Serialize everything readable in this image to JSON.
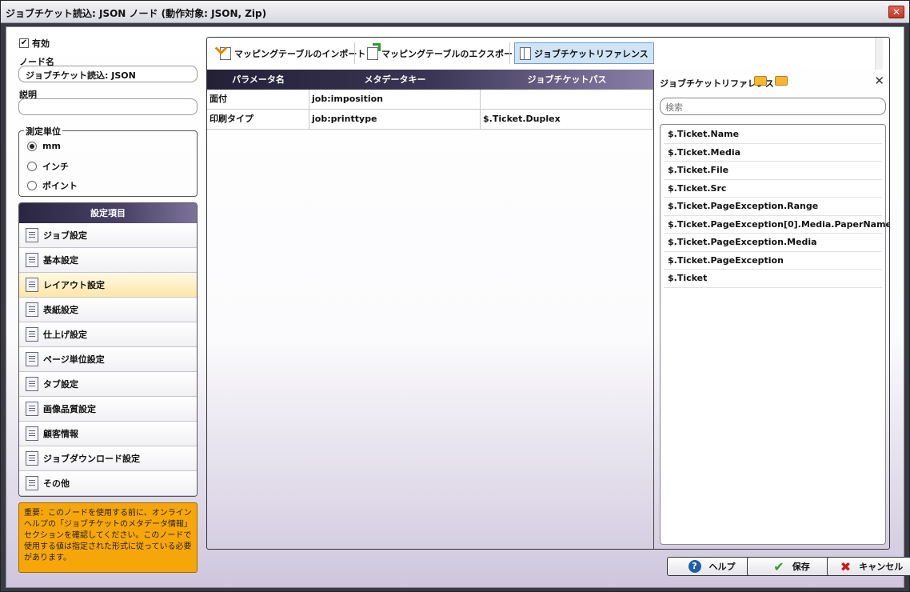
{
  "window": {
    "title": "ジョブチケット読込: JSON ノード (動作対象: JSON, Zip)"
  },
  "left": {
    "enabled_label": "有効",
    "enabled_checked": true,
    "node_name_label": "ノード名",
    "node_name_value": "ジョブチケット読込: JSON",
    "description_label": "説明",
    "description_value": "",
    "unit_group_label": "測定単位",
    "units": [
      {
        "label": "mm",
        "selected": true
      },
      {
        "label": "インチ",
        "selected": false
      },
      {
        "label": "ポイント",
        "selected": false
      }
    ],
    "settings_header": "設定項目",
    "settings_items": [
      {
        "label": "ジョブ設定",
        "icon": "document-icon",
        "active": false
      },
      {
        "label": "基本設定",
        "icon": "list-icon",
        "active": false
      },
      {
        "label": "レイアウト設定",
        "icon": "layout-icon",
        "active": true
      },
      {
        "label": "表紙設定",
        "icon": "cover-icon",
        "active": false
      },
      {
        "label": "仕上げ設定",
        "icon": "finishing-icon",
        "active": false
      },
      {
        "label": "ページ単位設定",
        "icon": "pages-icon",
        "active": false
      },
      {
        "label": "タブ設定",
        "icon": "tab-icon",
        "active": false
      },
      {
        "label": "画像品質設定",
        "icon": "image-icon",
        "active": false
      },
      {
        "label": "顧客情報",
        "icon": "customer-icon",
        "active": false
      },
      {
        "label": "ジョブダウンロード設定",
        "icon": "download-icon",
        "active": false
      },
      {
        "label": "その他",
        "icon": "other-icon",
        "active": false
      }
    ],
    "notice": "重要：このノードを使用する前に、オンラインヘルプの「ジョブチケットのメタデータ情報」セクションを確認してください。このノードで使用する値は指定された形式に従っている必要があります。"
  },
  "toolbar": {
    "import_label": "マッピングテーブルのインポート",
    "export_label": "マッピングテーブルのエクスポート",
    "reference_label": "ジョブチケットリファレンス"
  },
  "table": {
    "headers": [
      "パラメータ名",
      "メタデータキー",
      "ジョブチケットパス"
    ],
    "rows": [
      [
        "面付",
        "job:imposition",
        ""
      ],
      [
        "印刷タイプ",
        "job:printtype",
        "$.Ticket.Duplex"
      ]
    ]
  },
  "reference": {
    "title": "ジョブチケットリファレンス",
    "search_placeholder": "検索",
    "items": [
      "$.Ticket.Name",
      "$.Ticket.Media",
      "$.Ticket.File",
      "$.Ticket.Src",
      "$.Ticket.PageException.Range",
      "$.Ticket.PageException[0].Media.PaperName",
      "$.Ticket.PageException.Media",
      "$.Ticket.PageException",
      "$.Ticket"
    ]
  },
  "buttons": {
    "help": "ヘルプ",
    "save": "保存",
    "cancel": "キャンセル"
  }
}
